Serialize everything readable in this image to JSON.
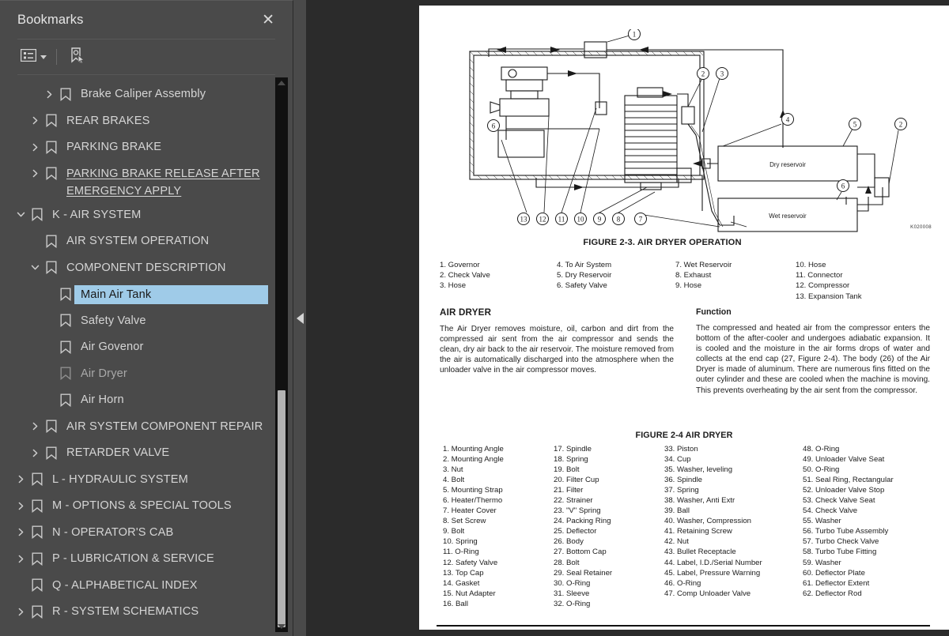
{
  "panel": {
    "title": "Bookmarks",
    "close_label": "✕",
    "toolbar": {
      "options_icon": "list-options-icon",
      "new_bookmark_icon": "new-bookmark-icon"
    }
  },
  "tree": [
    {
      "label": "Brake Caliper Assembly",
      "depth": 2,
      "twisty": "collapsed",
      "selected": false,
      "underline": false,
      "dim": false
    },
    {
      "label": "REAR BRAKES",
      "depth": 1,
      "twisty": "collapsed",
      "selected": false,
      "underline": false,
      "dim": false
    },
    {
      "label": "PARKING BRAKE",
      "depth": 1,
      "twisty": "collapsed",
      "selected": false,
      "underline": false,
      "dim": false
    },
    {
      "label": "PARKING BRAKE RELEASE AFTER\nEMERGENCY APPLY",
      "depth": 1,
      "twisty": "collapsed",
      "selected": false,
      "underline": true,
      "dim": false
    },
    {
      "label": "K - AIR SYSTEM",
      "depth": 0,
      "twisty": "expanded",
      "selected": false,
      "underline": false,
      "dim": false
    },
    {
      "label": "AIR SYSTEM OPERATION",
      "depth": 1,
      "twisty": "none",
      "selected": false,
      "underline": false,
      "dim": false
    },
    {
      "label": "COMPONENT DESCRIPTION",
      "depth": 1,
      "twisty": "expanded",
      "selected": false,
      "underline": false,
      "dim": false
    },
    {
      "label": "Main Air Tank",
      "depth": 2,
      "twisty": "none",
      "selected": true,
      "underline": false,
      "dim": false
    },
    {
      "label": "Safety Valve",
      "depth": 2,
      "twisty": "none",
      "selected": false,
      "underline": false,
      "dim": false
    },
    {
      "label": "Air Govenor",
      "depth": 2,
      "twisty": "none",
      "selected": false,
      "underline": false,
      "dim": false
    },
    {
      "label": "Air Dryer",
      "depth": 2,
      "twisty": "none",
      "selected": false,
      "underline": false,
      "dim": true
    },
    {
      "label": "Air Horn",
      "depth": 2,
      "twisty": "none",
      "selected": false,
      "underline": false,
      "dim": false
    },
    {
      "label": "AIR SYSTEM COMPONENT REPAIR",
      "depth": 1,
      "twisty": "collapsed",
      "selected": false,
      "underline": false,
      "dim": false
    },
    {
      "label": "RETARDER VALVE",
      "depth": 1,
      "twisty": "collapsed",
      "selected": false,
      "underline": false,
      "dim": false
    },
    {
      "label": "L - HYDRAULIC SYSTEM",
      "depth": 0,
      "twisty": "collapsed",
      "selected": false,
      "underline": false,
      "dim": false
    },
    {
      "label": "M - OPTIONS & SPECIAL TOOLS",
      "depth": 0,
      "twisty": "collapsed",
      "selected": false,
      "underline": false,
      "dim": false
    },
    {
      "label": "N - OPERATOR'S CAB",
      "depth": 0,
      "twisty": "collapsed",
      "selected": false,
      "underline": false,
      "dim": false
    },
    {
      "label": "P - LUBRICATION & SERVICE",
      "depth": 0,
      "twisty": "collapsed",
      "selected": false,
      "underline": false,
      "dim": false
    },
    {
      "label": "Q - ALPHABETICAL INDEX",
      "depth": 0,
      "twisty": "none",
      "selected": false,
      "underline": false,
      "dim": false
    },
    {
      "label": "R - SYSTEM SCHEMATICS",
      "depth": 0,
      "twisty": "collapsed",
      "selected": false,
      "underline": false,
      "dim": false
    }
  ],
  "document": {
    "figure_2_3": {
      "caption": "FIGURE 2-3. AIR DRYER OPERATION",
      "drawing_code": "K020008",
      "labels_in_drawing": [
        "Dry reservoir",
        "Wet reservoir"
      ],
      "callouts": [
        "1",
        "2",
        "3",
        "4",
        "5",
        "2",
        "6",
        "6",
        "7",
        "8",
        "9",
        "10",
        "11",
        "12",
        "13"
      ],
      "legend_columns": [
        [
          "1. Governor",
          "2. Check Valve",
          "3. Hose"
        ],
        [
          "4. To Air System",
          "5. Dry Reservoir",
          "6. Safety Valve"
        ],
        [
          "7. Wet Reservoir",
          "8. Exhaust",
          "9. Hose"
        ],
        [
          "10. Hose",
          "11. Connector",
          "12. Compressor",
          "13. Expansion Tank"
        ]
      ]
    },
    "air_dryer_section": {
      "heading": "AIR DRYER",
      "text": "The Air Dryer removes moisture, oil, carbon and dirt from the compressed air sent from the air compressor and sends the clean, dry air back to the air reservoir. The moisture removed from the air is automatically discharged into the atmosphere when the unloader valve in the air compressor moves."
    },
    "function_section": {
      "heading": "Function",
      "text": "The compressed and heated air from the compressor enters the bottom of the after-cooler and undergoes adiabatic expansion. It is cooled and the moisture in the air forms drops of water and collects at the end cap (27, Figure 2-4). The body (26) of the Air Dryer is made of aluminum. There are numerous fins fitted on the outer cylinder and these are cooled when the machine is moving. This prevents overheating by the air sent from the compressor."
    },
    "figure_2_4": {
      "caption": "FIGURE 2-4 AIR DRYER",
      "parts_columns": [
        [
          "1. Mounting Angle",
          "2. Mounting Angle",
          "3. Nut",
          "4. Bolt",
          "5. Mounting Strap",
          "6. Heater/Thermo",
          "7. Heater Cover",
          "8. Set Screw",
          "9. Bolt",
          "10. Spring",
          "11. O-Ring",
          "12. Safety Valve",
          "13. Top Cap",
          "14. Gasket",
          "15. Nut Adapter",
          "16. Ball"
        ],
        [
          "17. Spindle",
          "18. Spring",
          "19. Bolt",
          "20. Filter Cup",
          "21. Filter",
          "22. Strainer",
          "23. \"V\" Spring",
          "24. Packing Ring",
          "25. Deflector",
          "26. Body",
          "27. Bottom Cap",
          "28. Bolt",
          "29. Seal Retainer",
          "30. O-Ring",
          "31. Sleeve",
          "32. O-Ring"
        ],
        [
          "33. Piston",
          "34. Cup",
          "35. Washer, leveling",
          "36. Spindle",
          "37. Spring",
          "38. Washer, Anti Extr",
          "39. Ball",
          "40. Washer, Compression",
          "41. Retaining Screw",
          "42. Nut",
          "43. Bullet Receptacle",
          "44. Label, I.D./Serial Number",
          "45. Label, Pressure Warning",
          "46. O-Ring",
          "47. Comp Unloader Valve"
        ],
        [
          "48. O-Ring",
          "49. Unloader Valve Seat",
          "50. O-Ring",
          "51. Seal Ring, Rectangular",
          "52. Unloader Valve Stop",
          "53. Check Valve Seat",
          "54. Check Valve",
          "55. Washer",
          "56. Turbo Tube Assembly",
          "57. Turbo Check Valve",
          "58. Turbo Tube Fitting",
          "59. Washer",
          "60. Deflector Plate",
          "61. Deflector Extent",
          "62. Deflector Rod"
        ]
      ]
    }
  },
  "colors": {
    "panel_bg": "#4a4a4a",
    "viewport_bg": "#2b2b2b",
    "selection": "#9fcbe8",
    "page_bg": "#ffffff",
    "scrollbar_track": "#111111",
    "scrollbar_thumb": "#b3b3b3"
  }
}
